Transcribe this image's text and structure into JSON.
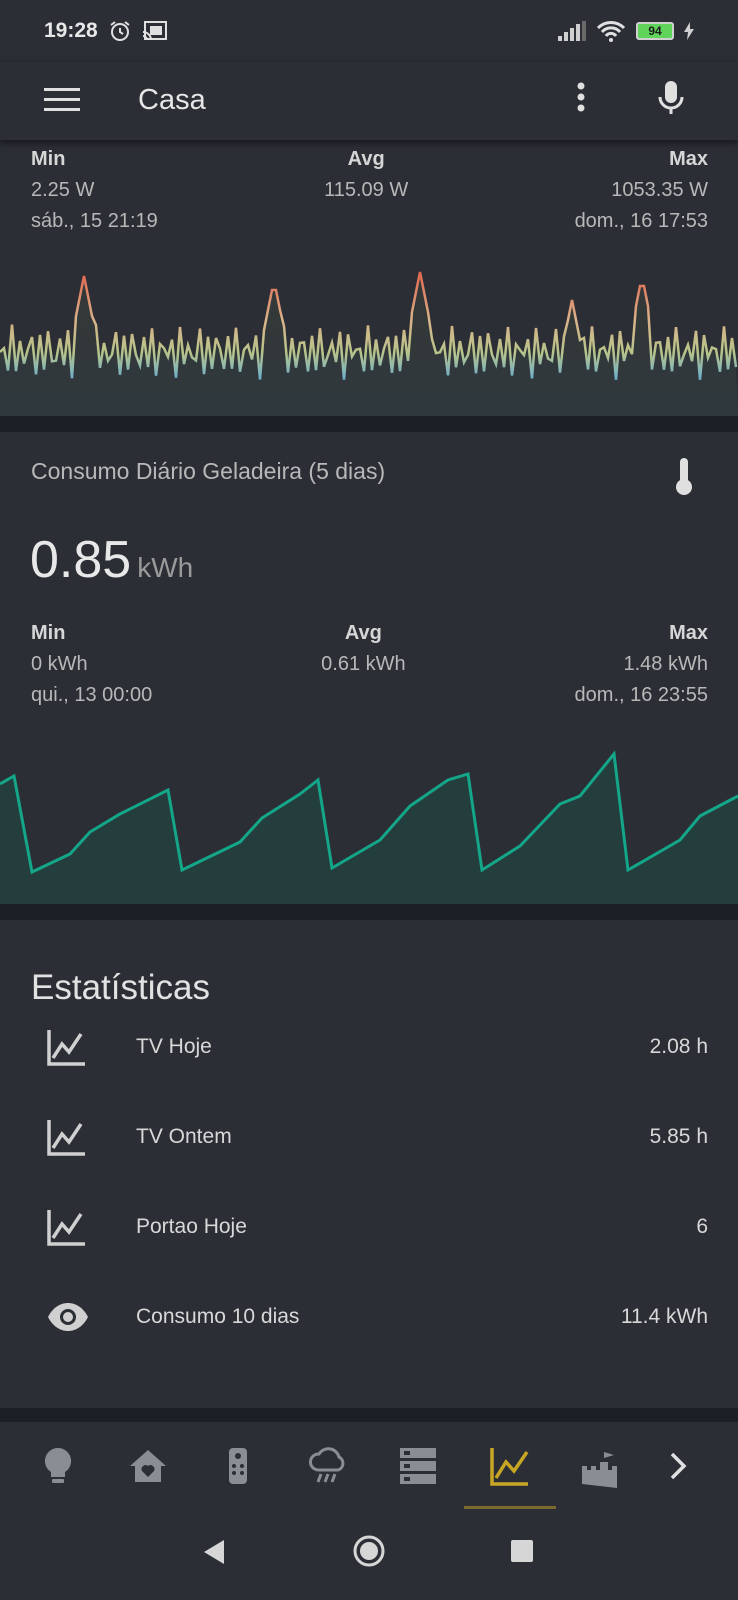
{
  "status_bar": {
    "time": "19:28",
    "battery": "94"
  },
  "toolbar": {
    "title": "Casa"
  },
  "power_card": {
    "min_label": "Min",
    "min_value": "2.25 W",
    "min_time": "sáb., 15 21:19",
    "avg_label": "Avg",
    "avg_value": "115.09 W",
    "max_label": "Max",
    "max_value": "1053.35 W",
    "max_time": "dom., 16 17:53"
  },
  "fridge_card": {
    "title": "Consumo Diário Geladeira (5 dias)",
    "value": "0.85",
    "unit": "kWh",
    "min_label": "Min",
    "min_value": "0 kWh",
    "min_time": "qui., 13 00:00",
    "avg_label": "Avg",
    "avg_value": "0.61 kWh",
    "max_label": "Max",
    "max_value": "1.48 kWh",
    "max_time": "dom., 16 23:55"
  },
  "stats_card": {
    "title": "Estatísticas",
    "rows": [
      {
        "name": "TV Hoje",
        "value": "2.08 h",
        "icon": "chart-line-icon"
      },
      {
        "name": "TV Ontem",
        "value": "5.85 h",
        "icon": "chart-line-icon"
      },
      {
        "name": "Portao Hoje",
        "value": "6",
        "icon": "chart-line-icon"
      },
      {
        "name": "Consumo 10 dias",
        "value": "11.4 kWh",
        "icon": "eye-icon"
      }
    ]
  },
  "bottom_nav": {
    "items": [
      "lightbulb-icon",
      "home-heart-icon",
      "remote-icon",
      "weather-rainy-icon",
      "server-icon",
      "chart-line-icon",
      "castle-icon",
      "chevron-right-icon"
    ],
    "active_index": 5
  },
  "colors": {
    "accent": "#c9a623",
    "fridge_line": "#14a689",
    "power_low": "#7fb7c9",
    "power_high": "#e0664e"
  }
}
